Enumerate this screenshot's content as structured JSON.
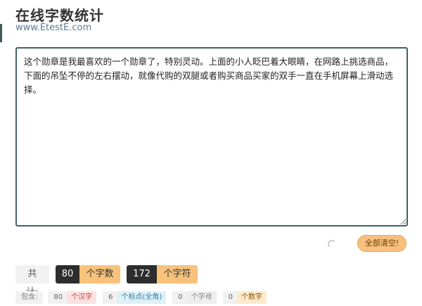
{
  "header": {
    "title": "在线字数统计",
    "subtitle": "www.EtestE.com"
  },
  "editor": {
    "value": "这个勋章是我最喜欢的一个勋章了，特别灵动。上面的小人眨巴着大眼睛，在网路上挑选商品，下面的吊坠不停的左右摆动，就像代购的双腿或者购买商品买家的双手一直在手机屏幕上滑动选择。"
  },
  "actions": {
    "clear_label": "全部清空!"
  },
  "totals": {
    "label": "共计:",
    "words_count": "80",
    "words_label": "个字数",
    "chars_count": "172",
    "chars_label": "个字符"
  },
  "details": {
    "prefix": "包含:",
    "items": [
      {
        "count": "80",
        "label": "个汉字",
        "color": "#d23b3b"
      },
      {
        "count": "6",
        "label": "个标点(全角)",
        "color": "#2a7fa8"
      },
      {
        "count": "0",
        "label": "个字母",
        "color": "#888888"
      },
      {
        "count": "0",
        "label": "个数字",
        "color": "#8a5500"
      }
    ]
  },
  "colors": {
    "accent": "#3f6463",
    "orange": "#f8c27b",
    "dark": "#2d2d2d"
  }
}
